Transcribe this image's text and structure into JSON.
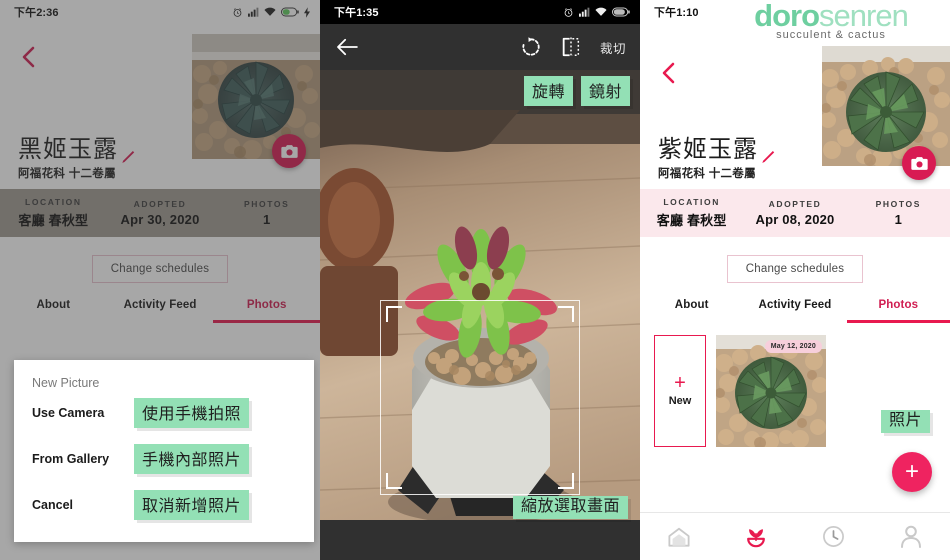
{
  "panels": {
    "left": {
      "status": {
        "time": "下午2:36",
        "icons": [
          "alarm-icon",
          "signal-icon",
          "wifi-icon",
          "battery-icon",
          "charging-icon"
        ]
      },
      "back_icon": "chevron-left-icon",
      "camera_icon": "camera-icon",
      "edit_icon": "pencil-icon",
      "plant_name": "黑姬玉露",
      "plant_family": "阿福花科 十二卷屬",
      "stats": [
        {
          "key": "LOCATION",
          "value": "客廳 春秋型"
        },
        {
          "key": "ADOPTED",
          "value": "Apr 30, 2020"
        },
        {
          "key": "PHOTOS",
          "value": "1"
        }
      ],
      "schedule_button": "Change schedules",
      "tabs": [
        {
          "label": "About",
          "active": false
        },
        {
          "label": "Activity Feed",
          "active": false
        },
        {
          "label": "Photos",
          "active": true
        }
      ],
      "dialog": {
        "title": "New Picture",
        "rows": [
          {
            "label": "Use Camera",
            "callout": "使用手機拍照"
          },
          {
            "label": "From Gallery",
            "callout": "手機內部照片"
          },
          {
            "label": "Cancel",
            "callout": "取消新增照片"
          }
        ]
      }
    },
    "middle": {
      "status": {
        "time": "下午1:35",
        "icons": [
          "alarm-icon",
          "signal-icon",
          "wifi-icon",
          "battery-icon"
        ]
      },
      "toolbar": {
        "back_icon": "arrow-left-icon",
        "rotate_icon": "rotate-icon",
        "mirror_icon": "mirror-icon",
        "crop_label": "裁切"
      },
      "callouts": {
        "rotate": "旋轉",
        "mirror": "鏡射",
        "crop_frame": "縮放選取畫面"
      }
    },
    "right": {
      "status": {
        "time": "下午1:10",
        "icons": []
      },
      "logo": {
        "bold": "doro",
        "light": "senren",
        "tagline": "succulent & cactus"
      },
      "back_icon": "chevron-left-icon",
      "camera_icon": "camera-icon",
      "edit_icon": "pencil-icon",
      "plant_name": "紫姬玉露",
      "plant_family": "阿福花科 十二卷屬",
      "stats": [
        {
          "key": "LOCATION",
          "value": "客廳 春秋型"
        },
        {
          "key": "ADOPTED",
          "value": "Apr 08, 2020"
        },
        {
          "key": "PHOTOS",
          "value": "1"
        }
      ],
      "schedule_button": "Change schedules",
      "tabs": [
        {
          "label": "About",
          "active": false
        },
        {
          "label": "Activity Feed",
          "active": false
        },
        {
          "label": "Photos",
          "active": true
        }
      ],
      "gallery": {
        "new_plus": "+",
        "new_label": "New",
        "photo_date": "May 12, 2020",
        "fab": "+",
        "callout": "照片"
      },
      "bottom_nav": [
        {
          "icon": "home-icon",
          "active": false
        },
        {
          "icon": "plant-icon",
          "active": true
        },
        {
          "icon": "history-icon",
          "active": false
        },
        {
          "icon": "profile-icon",
          "active": false
        }
      ]
    }
  },
  "colors": {
    "accent_pink": "#e8194f",
    "accent_dark_pink": "#d01d51",
    "callout_green": "#93e0b5",
    "logo_green": "#6ecfa0",
    "stat_bar_left": "#9f9991",
    "stat_bar_right": "#fbe8ec"
  }
}
